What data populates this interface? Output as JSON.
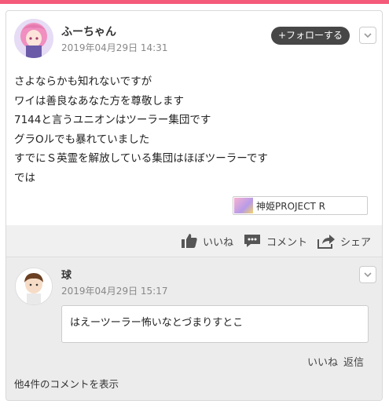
{
  "colors": {
    "accent_bar": "#f45a7a",
    "follow_button_bg": "#474747",
    "action_bar_bg": "#f0f0f0",
    "comment_section_bg": "#ececec"
  },
  "post": {
    "username": "ふーちゃん",
    "timestamp": "2019年04月29日 14:31",
    "follow_label": "+フォローする",
    "body_lines": [
      "さよならかも知れないですが",
      "ワイは善良なあなた方を尊敬します",
      "7144と言うユニオンはツーラー集団です",
      "グラOルでも暴れていました",
      "すでにＳ英霊を解放している集団はほぼツーラーです",
      "では"
    ],
    "game_tag": "神姫PROJECT R"
  },
  "actions": {
    "like_label": "いいね",
    "comment_label": "コメント",
    "share_label": "シェア"
  },
  "comment": {
    "username": "球",
    "timestamp": "2019年04月29日 15:17",
    "text": "はえーツーラー怖いなとづまりすとこ",
    "like_label": "いいね",
    "reply_label": "返信"
  },
  "more_comments_label": "他4件のコメントを表示",
  "icons": [
    "chevron-down-icon",
    "thumbs-up-icon",
    "comment-icon",
    "share-icon"
  ]
}
